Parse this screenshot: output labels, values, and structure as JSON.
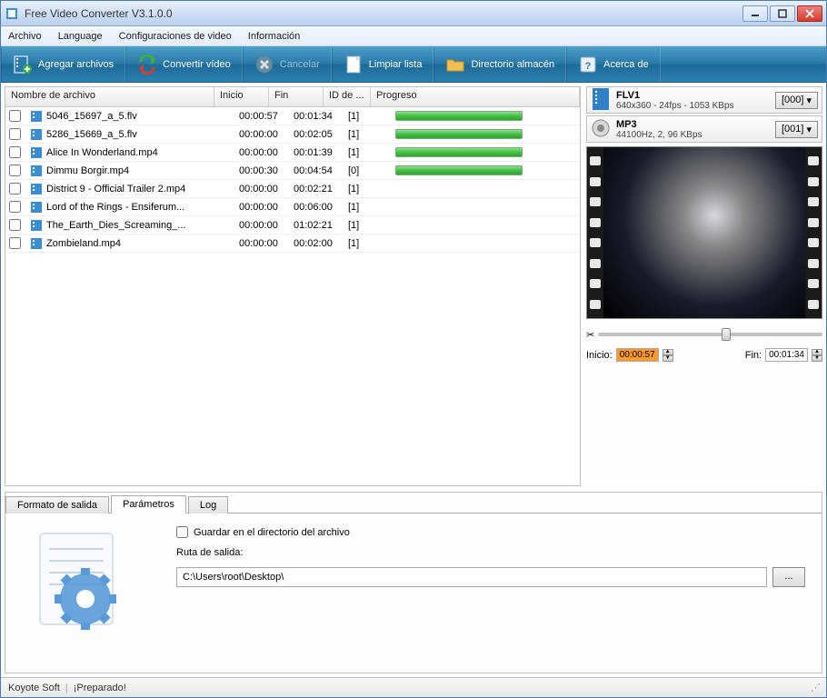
{
  "app": {
    "title": "Free Video Converter V3.1.0.0"
  },
  "menu": {
    "file": "Archivo",
    "language": "Language",
    "video_config": "Configuraciones de video",
    "info": "Información"
  },
  "toolbar": {
    "add": "Agregar archivos",
    "convert": "Convertir vídeo",
    "cancel": "Cancelar",
    "clear": "Limpiar lista",
    "dir": "Directorio almacén",
    "about": "Acerca de"
  },
  "columns": {
    "name": "Nombre de archivo",
    "start": "Inicio",
    "end": "Fin",
    "id": "ID de ...",
    "progress": "Progreso"
  },
  "files": [
    {
      "name": "5046_15697_a_5.flv",
      "start": "00:00:57",
      "end": "00:01:34",
      "id": "[1]",
      "done": true
    },
    {
      "name": "5286_15669_a_5.flv",
      "start": "00:00:00",
      "end": "00:02:05",
      "id": "[1]",
      "done": true
    },
    {
      "name": "Alice In Wonderland.mp4",
      "start": "00:00:00",
      "end": "00:01:39",
      "id": "[1]",
      "done": true
    },
    {
      "name": "Dimmu Borgir.mp4",
      "start": "00:00:30",
      "end": "00:04:54",
      "id": "[0]",
      "done": true
    },
    {
      "name": "District 9 - Official Trailer 2.mp4",
      "start": "00:00:00",
      "end": "00:02:21",
      "id": "[1]",
      "done": false
    },
    {
      "name": "Lord of the Rings - Ensiferum...",
      "start": "00:00:00",
      "end": "00:06:00",
      "id": "[1]",
      "done": false
    },
    {
      "name": "The_Earth_Dies_Screaming_...",
      "start": "00:00:00",
      "end": "01:02:21",
      "id": "[1]",
      "done": false
    },
    {
      "name": "Zombieland.mp4",
      "start": "00:00:00",
      "end": "00:02:00",
      "id": "[1]",
      "done": false
    }
  ],
  "video_format": {
    "name": "FLV1",
    "detail": "640x360 - 24fps - 1053 KBps",
    "code": "[000]"
  },
  "audio_format": {
    "name": "MP3",
    "detail": "44100Hz, 2, 96 KBps",
    "code": "[001]"
  },
  "trim": {
    "start_label": "Inicio:",
    "end_label": "Fin:",
    "start": "00:00:57",
    "end": "00:01:34"
  },
  "tabs": {
    "output": "Formato de salida",
    "params": "Parámetros",
    "log": "Log"
  },
  "params": {
    "save_in_dir": "Guardar en el directorio del archivo",
    "output_path_label": "Ruta de salida:",
    "output_path": "C:\\Users\\root\\Desktop\\",
    "browse": "..."
  },
  "status": {
    "brand": "Koyote Soft",
    "ready": "¡Preparado!"
  }
}
